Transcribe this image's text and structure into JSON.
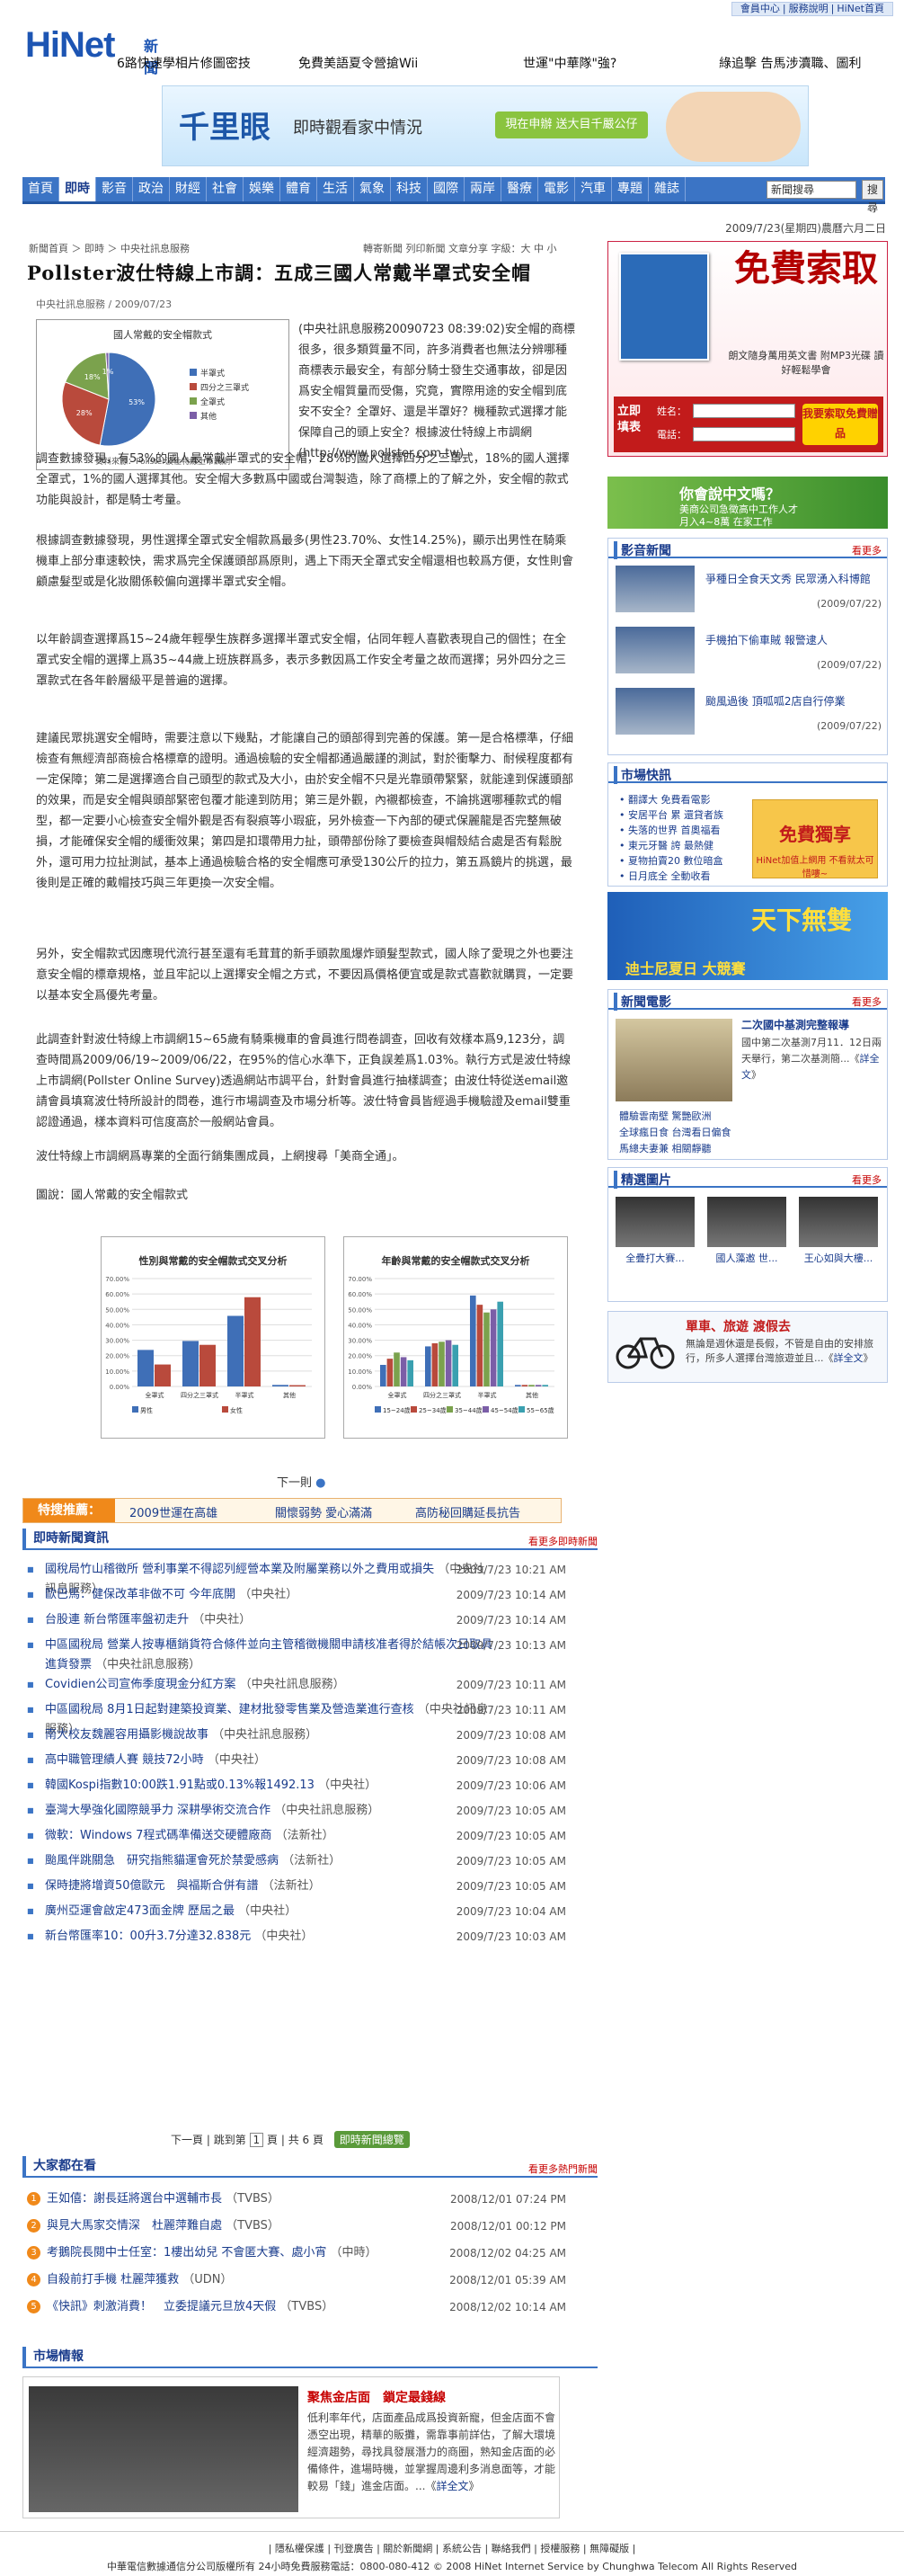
{
  "toplinks": [
    "會員中心",
    "服務說明",
    "HiNet首頁"
  ],
  "brand": {
    "logo": "HiNet",
    "sub": "新聞"
  },
  "headlines": [
    "6路快速學相片修圖密技",
    "免費美語夏令營搶Wii",
    "世運\"中華隊\"強?",
    "綠追擊 告馬涉瀆職、圖利"
  ],
  "banner": {
    "t1": "千里眼",
    "t2": "即時觀看家中情況",
    "btn": "現在申辦 送大目千嚴公仔"
  },
  "nav": {
    "items": [
      "首頁",
      "即時",
      "影音",
      "政治",
      "財經",
      "社會",
      "娛樂",
      "體育",
      "生活",
      "氣象",
      "科技",
      "國際",
      "兩岸",
      "醫療",
      "電影",
      "汽車",
      "專題",
      "雜誌"
    ],
    "active": 1,
    "search_value": "新聞搜尋",
    "search_btn": "搜尋"
  },
  "dateline": "2009/7/23(星期四)農曆六月二日",
  "breadcrumb": "新聞首頁 ＞ 即時 ＞ 中央社訊息服務",
  "tools": "轉寄新聞  列印新聞  文章分享  字級：大 中 小",
  "article": {
    "title": "Pollster波仕特線上市調：五成三國人常戴半罩式安全帽",
    "meta": "中央社訊息服務 / 2009/07/23",
    "fig_title": "國人常戴的安全帽款式",
    "fig_caption": "資料來源：Pollster波仕特線上市調網",
    "p0": "(中央社訊息服務20090723 08:39:02)安全帽的商標很多，很多類質量不同，許多消費者也無法分辨哪種商標表示最安全，有部分騎士發生交通事故，卻是因爲安全帽質量而受傷，究竟，實際用途的安全帽到底安不安全？全罩好、還是半罩好？機種款式選擇才能保障自己的頭上安全？根據波仕特線上市調網(http://www.pollster.com.tw)",
    "p0b": "調查數據發現，有53%的國人最常戴半罩式的安全帽，28%的國人選擇四分之三罩式，18%的國人選擇全罩式，1%的國人選擇其他。安全帽大多數爲中國或台灣製造，除了商標上的了解之外，安全帽的款式功能與設計，都是騎士考量。",
    "p1": "根據調查數據發現，男性選擇全罩式安全帽款爲最多(男性23.70%、女性14.25%)，顯示出男性在騎乘機車上部分車速較快，需求爲完全保護頭部爲原則，遇上下雨天全罩式安全帽還相也較爲方便，女性則會顧慮髮型或是化妝關係較偏向選擇半罩式安全帽。",
    "p2": "以年齡調查選擇爲15~24歲年輕學生族群多選擇半罩式安全帽，佔同年輕人喜歡表現自己的個性；在全罩式安全帽的選擇上爲35~44歲上班族群爲多，表示多數因爲工作安全考量之故而選擇；另外四分之三罩款式在各年齡層級平是普遍的選擇。",
    "p3": "建議民眾挑選安全帽時，需要注意以下幾點，才能讓自己的頭部得到完善的保護。第一是合格標準，仔細檢查有無經濟部商檢合格標章的證明。通過檢驗的安全帽都通過嚴謹的測試，對於衝擊力、耐候程度都有一定保障；第二是選擇適合自己頭型的款式及大小，由於安全帽不只是光靠頭帶緊緊，就能達到保護頭部的效果，而是安全帽與頭部緊密包覆才能達到防用；第三是外觀，內襯都檢查，不論挑選哪種款式的帽型，都一定要小心檢查安全帽外觀是否有裂痕等小瑕疵，另外檢查一下內部的硬式保麗龍是否完整無破損，才能確保安全帽的緩衝效果；第四是扣環帶用力扯，頭帶部份除了要檢查與帽殼結合處是否有鬆脫外，還可用力拉扯測試，基本上通過檢驗合格的安全帽應可承受130公斤的拉力，第五爲鏡片的挑選，最後則是正確的戴帽技巧與三年更換一次安全帽。",
    "p4": "另外，安全帽款式因應現代流行甚至還有毛茸茸的新手頭款風爆炸頭髮型款式，國人除了愛現之外也要注意安全帽的標章規格，並且牢記以上選擇安全帽之方式，不要因爲價格便宜或是款式喜歡就購買，一定要以基本安全爲優先考量。",
    "p5": "此調查針對波仕特線上市調網15~65歲有騎乘機車的會員進行問卷調查，回收有效樣本爲9,123分，調查時間爲2009/06/19~2009/06/22，在95%的信心水準下，正負誤差爲1.03%。執行方式是波仕特線上市調網(Pollster Online Survey)透過網站市調平台，針對會員進行抽樣調查；由波仕特從送email邀請會員填寫波仕特所設計的問卷，進行市場調查及市場分析等。波仕特會員皆經過手機驗證及email雙重認證通過，樣本資料可信度高於一般網站會員。",
    "p6": "波仕特線上市調網爲專業的全面行銷集團成員，上網搜尋「美商全通」。",
    "p7": "圖說：國人常戴的安全帽款式",
    "next": "下一則"
  },
  "chart_data": [
    {
      "type": "pie",
      "title": "國人常戴的安全帽款式",
      "categories": [
        "半罩式",
        "四分之三罩式",
        "全罩式",
        "其他"
      ],
      "values": [
        53,
        28,
        18,
        1
      ],
      "legend_placement": "right"
    },
    {
      "type": "bar",
      "title": "性別與常戴的安全帽款式交叉分析",
      "categories": [
        "全罩式",
        "四分之三罩式",
        "半罩式",
        "其他"
      ],
      "series": [
        {
          "name": "男性",
          "values": [
            23.7,
            29.5,
            45.8,
            1.0
          ]
        },
        {
          "name": "女性",
          "values": [
            14.25,
            27.0,
            57.9,
            0.85
          ]
        }
      ],
      "ylim": [
        0,
        70
      ]
    },
    {
      "type": "bar",
      "title": "年齡與常戴的安全帽款式交叉分析",
      "categories": [
        "全罩式",
        "四分之三罩式",
        "半罩式",
        "其他"
      ],
      "series": [
        {
          "name": "15~24歲",
          "values": [
            14,
            26,
            59,
            1
          ]
        },
        {
          "name": "25~34歲",
          "values": [
            18,
            28,
            53,
            1
          ]
        },
        {
          "name": "35~44歲",
          "values": [
            22,
            29,
            48,
            1
          ]
        },
        {
          "name": "45~54歲",
          "values": [
            19,
            30,
            50,
            1
          ]
        },
        {
          "name": "55~65歲",
          "values": [
            17,
            27,
            55,
            1
          ]
        }
      ],
      "ylim": [
        0,
        70
      ]
    }
  ],
  "hot": {
    "label": "特搜推薦：",
    "items": [
      "2009世運在高雄",
      "關懷弱勢 愛心滿滿",
      "高防秘回購延長抗告"
    ]
  },
  "instant": {
    "title": "即時新聞資訊",
    "more": "看更多即時新聞",
    "items": [
      {
        "t": "國稅局竹山稽徵所 營利事業不得認列經營本業及附屬業務以外之費用或損失",
        "src": "（中央社訊息服務）",
        "d": "2009/7/23 10:21 AM"
      },
      {
        "t": "歐巴馬：健保改革非做不可 今年底開",
        "src": "（中央社）",
        "d": "2009/7/23 10:14 AM"
      },
      {
        "t": "台股連 新台幣匯率盤初走升",
        "src": "（中央社）",
        "d": "2009/7/23 10:14 AM"
      },
      {
        "t": "中區國稅局 營業人按專櫃銷貨符合條件並向主管稽徵機關申請核准者得於結帳次日取具進貨發票",
        "src": "（中央社訊息服務）",
        "d": "2009/7/23 10:13 AM"
      },
      {
        "t": "Covidien公司宣佈季度現金分紅方案",
        "src": "（中央社訊息服務）",
        "d": "2009/7/23 10:11 AM"
      },
      {
        "t": "中區國稅局 8月1日起對建築投資業、建材批發零售業及營造業進行查核",
        "src": "（中央社訊息服務）",
        "d": "2009/7/23 10:11 AM"
      },
      {
        "t": "南大校友魏麗容用攝影機說故事",
        "src": "（中央社訊息服務）",
        "d": "2009/7/23 10:08 AM"
      },
      {
        "t": "高中職管理績人賽 競技72小時",
        "src": "（中央社）",
        "d": "2009/7/23 10:08 AM"
      },
      {
        "t": "韓國Kospi指數10:00跌1.91點或0.13%報1492.13",
        "src": "（中央社）",
        "d": "2009/7/23 10:06 AM"
      },
      {
        "t": "臺灣大學強化國際競爭力 深耕學術交流合作",
        "src": "（中央社訊息服務）",
        "d": "2009/7/23 10:05 AM"
      },
      {
        "t": "微軟：Windows 7程式碼準備送交硬體廠商",
        "src": "（法新社）",
        "d": "2009/7/23 10:05 AM"
      },
      {
        "t": "颱風伴跳關急　研究指熊貓運會死於禁愛感病",
        "src": "（法新社）",
        "d": "2009/7/23 10:05 AM"
      },
      {
        "t": "保時捷將增資50億歐元　與福斯合併有譜",
        "src": "（法新社）",
        "d": "2009/7/23 10:05 AM"
      },
      {
        "t": "廣州亞運會啟定473面金牌 歷屆之最",
        "src": "（中央社）",
        "d": "2009/7/23 10:04 AM"
      },
      {
        "t": "新台幣匯率10：00升3.7分達32.838元",
        "src": "（中央社）",
        "d": "2009/7/23 10:03 AM"
      }
    ]
  },
  "pager": {
    "prev": "下一頁",
    "jump": "跳到第",
    "page": "1",
    "unit": "頁",
    "total": "共 6 頁",
    "btn": "即時新聞總覽"
  },
  "ranking": {
    "title": "大家都在看",
    "more": "看更多熱門新聞",
    "items": [
      {
        "n": "1",
        "t": "王如僖：謝長廷將選台中選輔市長",
        "src": "（TVBS）",
        "d": "2008/12/01 07:24 PM"
      },
      {
        "n": "2",
        "t": "與見大馬家交情深　杜麗萍難自處",
        "src": "（TVBS）",
        "d": "2008/12/01 00:12 PM"
      },
      {
        "n": "3",
        "t": "考鵝院長閱中士任室：1樓出幼兒 不會匿大賽、處小宵",
        "src": "（中時）",
        "d": "2008/12/02 04:25 AM"
      },
      {
        "n": "4",
        "t": "自殺前打手機 杜麗萍獲救",
        "src": "（UDN）",
        "d": "2008/12/01 05:39 AM"
      },
      {
        "n": "5",
        "t": "《快訊》刺激消費！　立委提議元旦放4天假",
        "src": "（TVBS）",
        "d": "2008/12/02 10:14 AM"
      }
    ]
  },
  "market": {
    "title": "市場情報",
    "mk_title": "聚焦金店面　鎖定最錢線",
    "mk_text": "低利率年代，店面產品成爲投資新寵，但金店面不會憑空出現，精華的販攤，需靠事前詳估，了解大環境經濟趨勢，尋找具發展潛力的商圈，熟知金店面的必備條件，進場時機，並掌握周邊利多消息面等，才能較易「錢」進金店面。...",
    "mk_more": "詳全文"
  },
  "footer": {
    "links": "| 隱私權保護 | 刊登廣告 | 關於新聞網 | 系統公告 | 聯絡我們 | 授權服務 | 無障礙版 |",
    "copy": "中華電信數據通信分公司版權所有 24小時免費服務電話：0800-080-412 © 2008 HiNet Internet Service by Chunghwa Telecom All Rights Reserved"
  },
  "right": {
    "promo1": {
      "big": "免費索取",
      "sm": "朗文隨身萬用英文書 附MP3光碟 讀好輕鬆學會",
      "form_label": "立即填表",
      "name_label": "姓名：",
      "phone_label": "電話：",
      "btn": "我要索取免費贈品"
    },
    "promo2": {
      "a": "你會說中文嗎？",
      "b": "美商公司急徵高中工作人才",
      "c": "月入4~8萬  在家工作"
    },
    "video": {
      "title": "影音新聞",
      "more": "看更多",
      "items": [
        {
          "t": "爭種日全食天文秀 民眾湧入科博館",
          "d": "(2009/07/22)"
        },
        {
          "t": "手機拍下偷車賊 報警逮人",
          "d": "(2009/07/22)"
        },
        {
          "t": "颱風過後 頂呱呱2店自行停業",
          "d": "(2009/07/22)"
        }
      ]
    },
    "markets": {
      "title": "市場快訊",
      "items": [
        "翻譯大 免費看電影",
        "安居平台 累 還貸者族",
        "失落的世界 首奧福看",
        "東元牙醫 誇 最熱健",
        "夏物拍賣20 數位暗盒",
        "日月底全 全動收看"
      ],
      "promo": "免費獨享",
      "promo2": "HiNet加值上網用 不看就太可惜嘍~"
    },
    "disney": {
      "d1": "天下無雙",
      "d2": "迪士尼夏日 大競賽"
    },
    "nmovie": {
      "title": "新聞電影",
      "more": "看更多",
      "mt": "二次國中基測完整報導",
      "mx": "國中第二次基測7月11．12日兩天舉行，第二次基測簡...",
      "mx_more": "詳全文",
      "links": [
        "體驗雲南壁 驚艷歐洲",
        "全球瘋日食 台灣看日偏食",
        "馬總夫妻兼 相關靜聽"
      ]
    },
    "pics": {
      "title": "精選圖片",
      "more": "看更多",
      "caps": [
        "全疊打大賽...",
        "國人藻邀 世...",
        "王心如與大樓..."
      ]
    },
    "travel": {
      "tt": "單車、旅遊 渡假去",
      "tx": "無論是週休還是長假，不管是自由的安排旅行，所多人選擇台灣旅遊並且...",
      "more": "詳全文"
    }
  }
}
